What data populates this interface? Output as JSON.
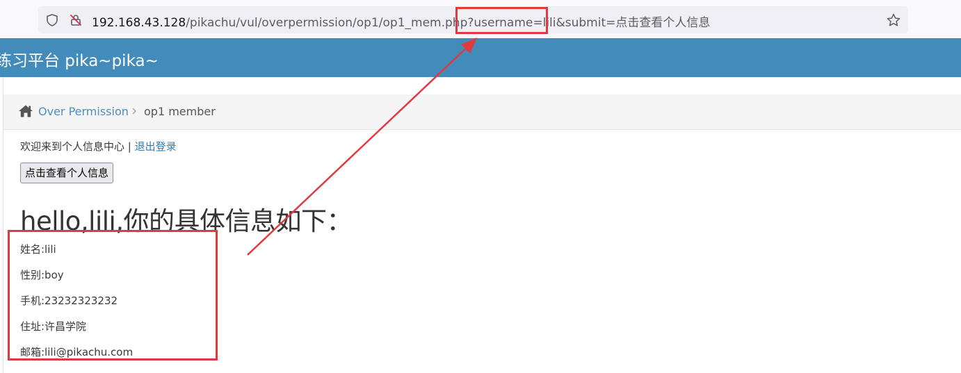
{
  "browser": {
    "url_host": "192.168.43.128",
    "url_path": "/pikachu/vul/overpermission/op1/op1_mem.php?username=lili&submit=点击查看个人信息",
    "icons": [
      "shield-icon",
      "insecure-lock-icon",
      "star-icon"
    ]
  },
  "header": {
    "title": "练习平台 pika~pika~"
  },
  "breadcrumb": {
    "link_label": "Over Permission",
    "current_label": "op1 member"
  },
  "main": {
    "welcome_text": "欢迎来到个人信息中心 | ",
    "logout_label": "退出登录",
    "view_button_label": "点击查看个人信息",
    "heading": "hello,lili,你的具体信息如下：",
    "info": [
      "姓名:lili",
      "性别:boy",
      "手机:23232323232",
      "住址:许昌学院",
      "邮箱:lili@pikachu.com"
    ]
  },
  "annotation": {
    "color": "#e0393f"
  },
  "colors": {
    "header_bg": "#428bba",
    "link": "#4c8fbd"
  }
}
